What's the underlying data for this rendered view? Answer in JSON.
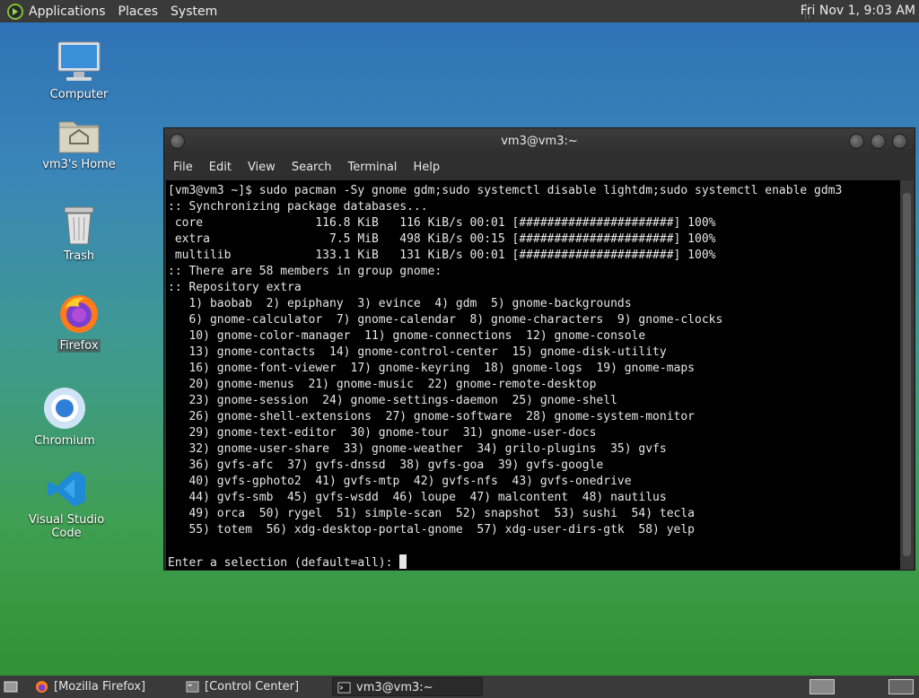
{
  "top_panel": {
    "menus": [
      "Applications",
      "Places",
      "System"
    ],
    "clock": "Fri Nov 1,  9:03 AM"
  },
  "desktop_icons": {
    "computer": "Computer",
    "home": "vm3's Home",
    "trash": "Trash",
    "firefox": "Firefox",
    "chromium": "Chromium",
    "vscode": "Visual Studio Code"
  },
  "terminal": {
    "title": "vm3@vm3:~",
    "menu": [
      "File",
      "Edit",
      "View",
      "Search",
      "Terminal",
      "Help"
    ],
    "lines": [
      "[vm3@vm3 ~]$ sudo pacman -Sy gnome gdm;sudo systemctl disable lightdm;sudo systemctl enable gdm3",
      ":: Synchronizing package databases...",
      " core                116.8 KiB   116 KiB/s 00:01 [######################] 100%",
      " extra                 7.5 MiB   498 KiB/s 00:15 [######################] 100%",
      " multilib            133.1 KiB   131 KiB/s 00:01 [######################] 100%",
      ":: There are 58 members in group gnome:",
      ":: Repository extra",
      "   1) baobab  2) epiphany  3) evince  4) gdm  5) gnome-backgrounds",
      "   6) gnome-calculator  7) gnome-calendar  8) gnome-characters  9) gnome-clocks",
      "   10) gnome-color-manager  11) gnome-connections  12) gnome-console",
      "   13) gnome-contacts  14) gnome-control-center  15) gnome-disk-utility",
      "   16) gnome-font-viewer  17) gnome-keyring  18) gnome-logs  19) gnome-maps",
      "   20) gnome-menus  21) gnome-music  22) gnome-remote-desktop",
      "   23) gnome-session  24) gnome-settings-daemon  25) gnome-shell",
      "   26) gnome-shell-extensions  27) gnome-software  28) gnome-system-monitor",
      "   29) gnome-text-editor  30) gnome-tour  31) gnome-user-docs",
      "   32) gnome-user-share  33) gnome-weather  34) grilo-plugins  35) gvfs",
      "   36) gvfs-afc  37) gvfs-dnssd  38) gvfs-goa  39) gvfs-google",
      "   40) gvfs-gphoto2  41) gvfs-mtp  42) gvfs-nfs  43) gvfs-onedrive",
      "   44) gvfs-smb  45) gvfs-wsdd  46) loupe  47) malcontent  48) nautilus",
      "   49) orca  50) rygel  51) simple-scan  52) snapshot  53) sushi  54) tecla",
      "   55) totem  56) xdg-desktop-portal-gnome  57) xdg-user-dirs-gtk  58) yelp",
      ""
    ],
    "prompt": "Enter a selection (default=all): "
  },
  "taskbar": {
    "tasks": [
      "[Mozilla Firefox]",
      "[Control Center]",
      "vm3@vm3:~"
    ]
  }
}
